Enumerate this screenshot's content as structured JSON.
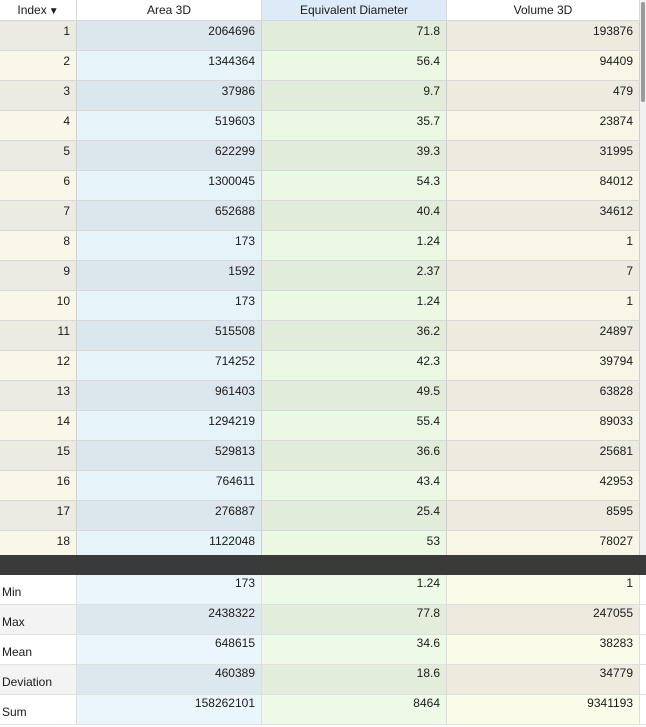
{
  "table": {
    "columns": [
      {
        "label": "Index",
        "sort_icon": "▼"
      },
      {
        "label": "Area 3D"
      },
      {
        "label": "Equivalent Diameter"
      },
      {
        "label": "Volume 3D"
      }
    ],
    "rows": [
      [
        "1",
        "2064696",
        "71.8",
        "193876"
      ],
      [
        "2",
        "1344364",
        "56.4",
        "94409"
      ],
      [
        "3",
        "37986",
        "9.7",
        "479"
      ],
      [
        "4",
        "519603",
        "35.7",
        "23874"
      ],
      [
        "5",
        "622299",
        "39.3",
        "31995"
      ],
      [
        "6",
        "1300045",
        "54.3",
        "84012"
      ],
      [
        "7",
        "652688",
        "40.4",
        "34612"
      ],
      [
        "8",
        "173",
        "1.24",
        "1"
      ],
      [
        "9",
        "1592",
        "2.37",
        "7"
      ],
      [
        "10",
        "173",
        "1.24",
        "1"
      ],
      [
        "11",
        "515508",
        "36.2",
        "24897"
      ],
      [
        "12",
        "714252",
        "42.3",
        "39794"
      ],
      [
        "13",
        "961403",
        "49.5",
        "63828"
      ],
      [
        "14",
        "1294219",
        "55.4",
        "89033"
      ],
      [
        "15",
        "529813",
        "36.6",
        "25681"
      ],
      [
        "16",
        "764611",
        "43.4",
        "42953"
      ],
      [
        "17",
        "276887",
        "25.4",
        "8595"
      ],
      [
        "18",
        "1122048",
        "53",
        "78027"
      ]
    ]
  },
  "stats": {
    "rows": [
      {
        "label": "Min",
        "values": [
          "173",
          "1.24",
          "1"
        ]
      },
      {
        "label": "Max",
        "values": [
          "2438322",
          "77.8",
          "247055"
        ]
      },
      {
        "label": "Mean",
        "values": [
          "648615",
          "34.6",
          "38283"
        ]
      },
      {
        "label": "Deviation",
        "values": [
          "460389",
          "18.6",
          "34779"
        ]
      },
      {
        "label": "Sum",
        "values": [
          "158262101",
          "8464",
          "9341193"
        ]
      }
    ]
  }
}
